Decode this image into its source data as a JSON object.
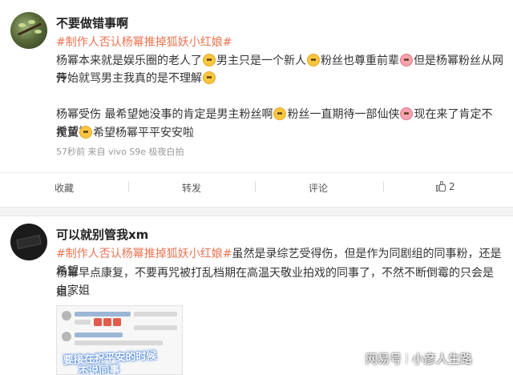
{
  "post1": {
    "username": "不要做错事啊",
    "topic": "#制作人否认杨幂推掉狐妖小红娘#",
    "line1": "杨幂本来就是娱乐圈的老人了",
    "line1b": "男主只是一个新人",
    "line1c": "粉丝也尊重前辈",
    "line1d": "但是杨幂粉丝从网传",
    "line2": "开始就骂男主我真的是不理解",
    "line3": "杨幂受伤 最希望她没事的肯定是男主粉丝啊",
    "line3b": "粉丝一直期待一部仙侠",
    "line3c": "现在来了肯定不希望被",
    "line4": "搅黄",
    "line4b": "希望杨幂平平安安啦",
    "meta": "57秒前  来自 vivo S9e 极夜白拍",
    "actions": {
      "favorite": "收藏",
      "repost": "转发",
      "comment": "评论",
      "like_count": "2"
    }
  },
  "post2": {
    "username": "可以就别管我xm",
    "topic": "#制作人否认杨幂推掉狐妖小红娘#",
    "line1": "虽然是录综艺受得伤，但是作为同剧组的同事粉，还是希望",
    "line2": "杨幂早点康复，不要再咒被打乱档期在高温天敬业拍戏的同事了，不然不断倒霉的只会是自家姐",
    "line3": "姐。",
    "preview_caption_1": "要接在祝平安的时候",
    "preview_caption_2": "不说同事"
  },
  "watermark": {
    "brand": "网易号",
    "author": "小彦人生路"
  },
  "colors": {
    "topic": "#eb7350",
    "meta": "#999999",
    "divider": "#f2f2f2"
  }
}
